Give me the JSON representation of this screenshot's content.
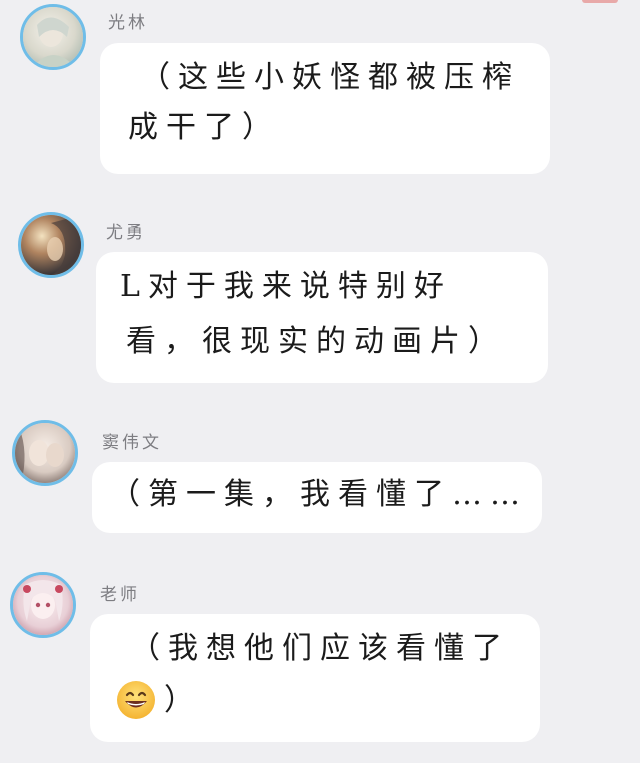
{
  "messages": [
    {
      "sender": "光林",
      "lines": [
        "（这些小妖怪都被压榨",
        "成干了）"
      ]
    },
    {
      "sender": "尤勇",
      "lines": [
        "L对于我来说特别好",
        "看，很现实的动画片）"
      ]
    },
    {
      "sender": "窦伟文",
      "lines": [
        "（第一集，我看懂了……"
      ]
    },
    {
      "sender": "老师",
      "lines": [
        "（我想他们应该看懂了",
        "）"
      ]
    }
  ],
  "emoji": {
    "name": "grinning-face-icon",
    "glyph": "😄"
  },
  "colors": {
    "background": "#efeff2",
    "bubble": "#ffffff",
    "avatar_ring": "#6fbde8",
    "name_text": "#7d7d82",
    "message_text": "#1b1b1b"
  }
}
